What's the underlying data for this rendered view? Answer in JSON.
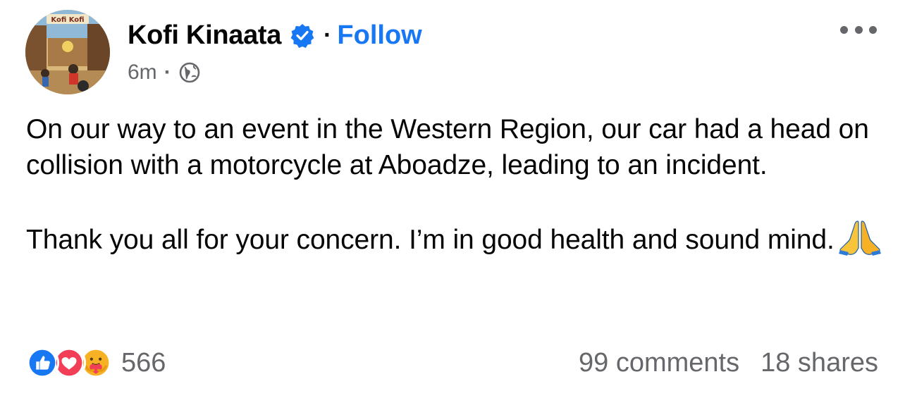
{
  "post": {
    "author": "Kofi Kinaata",
    "verified": true,
    "separator": "·",
    "follow_label": "Follow",
    "time": "6m",
    "meta_separator": "·",
    "audience_icon": "globe-icon",
    "avatar_text": "Kofi Kofi"
  },
  "body": {
    "paragraph_1": "On our way to an event in the Western Region, our car had a head on collision with a motorcycle at Aboadze, leading to an incident.",
    "paragraph_2": "Thank you all for your concern. I’m in good health and sound mind.",
    "emoji": "folded-hands-icon"
  },
  "footer": {
    "reaction_icons": [
      "like-icon",
      "love-icon",
      "care-icon"
    ],
    "reaction_count": "566",
    "comments": "99 comments",
    "shares": "18 shares"
  },
  "colors": {
    "accent": "#1877f2",
    "secondary_text": "#65676b",
    "love": "#f33e58",
    "care": "#f7b125"
  }
}
